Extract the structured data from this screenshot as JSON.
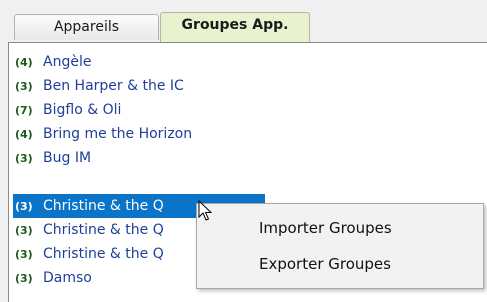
{
  "tabs": [
    {
      "label": "Appareils",
      "active": false
    },
    {
      "label": "Groupes App.",
      "active": true
    }
  ],
  "list": [
    {
      "count": "(4)",
      "name": "Angèle"
    },
    {
      "count": "(3)",
      "name": "Ben Harper &  the IC"
    },
    {
      "count": "(7)",
      "name": "Bigflo & Oli"
    },
    {
      "count": "(4)",
      "name": "Bring me the Horizon"
    },
    {
      "count": "(3)",
      "name": "Bug IM"
    },
    {
      "count": "(3)",
      "name": "Christine & the Q",
      "selected": true
    },
    {
      "count": "(3)",
      "name": "Christine & the Q"
    },
    {
      "count": "(3)",
      "name": "Christine & the Q"
    },
    {
      "count": "(3)",
      "name": "Damso"
    }
  ],
  "context_menu": {
    "items": [
      "Importer Groupes",
      "Exporter Groupes"
    ]
  },
  "colors": {
    "selection": "#0a74c9",
    "active_tab": "#e8f2cf",
    "name_text": "#1f3f9a",
    "count_text": "#1d5a1d"
  }
}
